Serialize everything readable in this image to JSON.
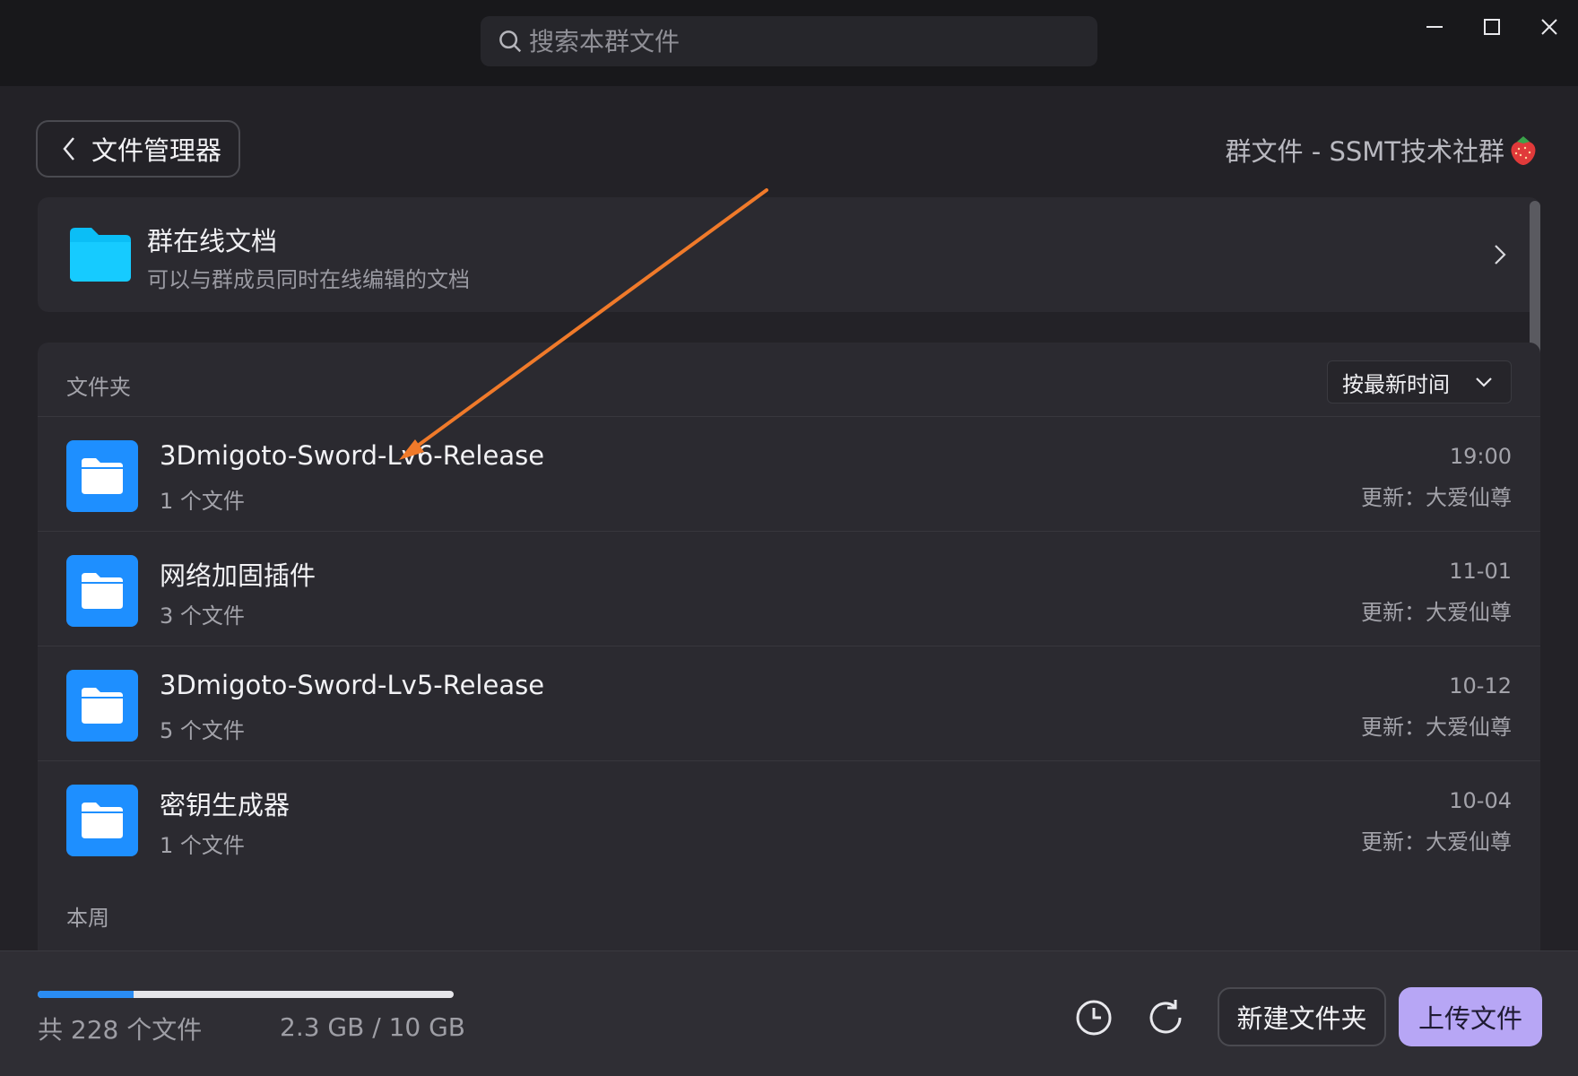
{
  "search": {
    "placeholder": "搜索本群文件"
  },
  "window": {
    "icons": [
      "minimize-icon",
      "maximize-icon",
      "close-icon"
    ]
  },
  "header": {
    "back_label": "文件管理器",
    "group_title": "群文件 - SSMT技术社群"
  },
  "online_docs": {
    "title": "群在线文档",
    "subtitle": "可以与群成员同时在线编辑的文档"
  },
  "folders": {
    "section_label": "文件夹",
    "sort_label": "按最新时间",
    "items": [
      {
        "name": "3Dmigoto-Sword-Lv6-Release",
        "count": "1 个文件",
        "date": "19:00",
        "updated_by": "更新：大爱仙尊"
      },
      {
        "name": "网络加固插件",
        "count": "3 个文件",
        "date": "11-01",
        "updated_by": "更新：大爱仙尊"
      },
      {
        "name": "3Dmigoto-Sword-Lv5-Release",
        "count": "5 个文件",
        "date": "10-12",
        "updated_by": "更新：大爱仙尊"
      },
      {
        "name": "密钥生成器",
        "count": "1 个文件",
        "date": "10-04",
        "updated_by": "更新：大爱仙尊"
      }
    ]
  },
  "week_section_label": "本周",
  "footer": {
    "total_files": "共 228 个文件",
    "storage": "2.3 GB / 10 GB",
    "storage_used_fraction": 0.23,
    "new_folder_label": "新建文件夹",
    "upload_label": "上传文件"
  },
  "colors": {
    "accent_blue": "#1e8fff",
    "upload_button": "#b7a6f5",
    "annotation_arrow": "#f07a2a",
    "online_docs_folder": "#12c2f5"
  }
}
